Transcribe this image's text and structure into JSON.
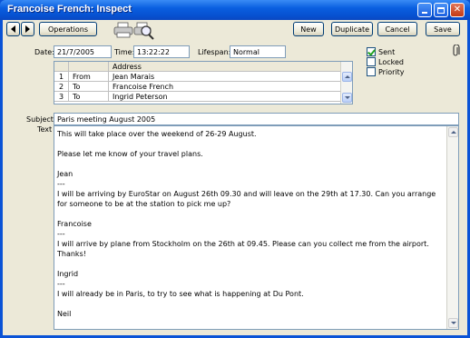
{
  "window": {
    "title": "Francoise French: Inspect"
  },
  "toolbar": {
    "operations_label": "Operations",
    "new_label": "New",
    "duplicate_label": "Duplicate",
    "cancel_label": "Cancel",
    "save_label": "Save"
  },
  "header": {
    "date_label": "Date:",
    "date_value": "21/7/2005",
    "time_label": "Time:",
    "time_value": "13:22:22",
    "lifespan_label": "Lifespan:",
    "lifespan_value": "Normal"
  },
  "flags": {
    "sent_label": "Sent",
    "sent_checked": true,
    "locked_label": "Locked",
    "locked_checked": false,
    "priority_label": "Priority",
    "priority_checked": false
  },
  "address_table": {
    "column_header": "Address",
    "rows": [
      {
        "num": "1",
        "type": "From",
        "address": "Jean Marais"
      },
      {
        "num": "2",
        "type": "To",
        "address": "Francoise French"
      },
      {
        "num": "3",
        "type": "To",
        "address": "Ingrid Peterson"
      }
    ]
  },
  "message": {
    "subject_label": "Subject:",
    "subject_value": "Paris meeting August 2005",
    "text_label": "Text",
    "body": "This will take place over the weekend of 26-29 August.\n\nPlease let me know of your travel plans.\n\nJean\n---\nI will be arriving by EuroStar on August 26th 09.30 and will leave on the 29th at 17.30. Can you arrange for someone to be at the station to pick me up?\n\nFrancoise\n---\nI will arrive by plane from Stockholm on the 26th at 09.45. Please can you collect me from the airport. Thanks!\n\nIngrid\n---\nI will already be in Paris, to try to see what is happening at Du Pont.\n\nNeil"
  }
}
